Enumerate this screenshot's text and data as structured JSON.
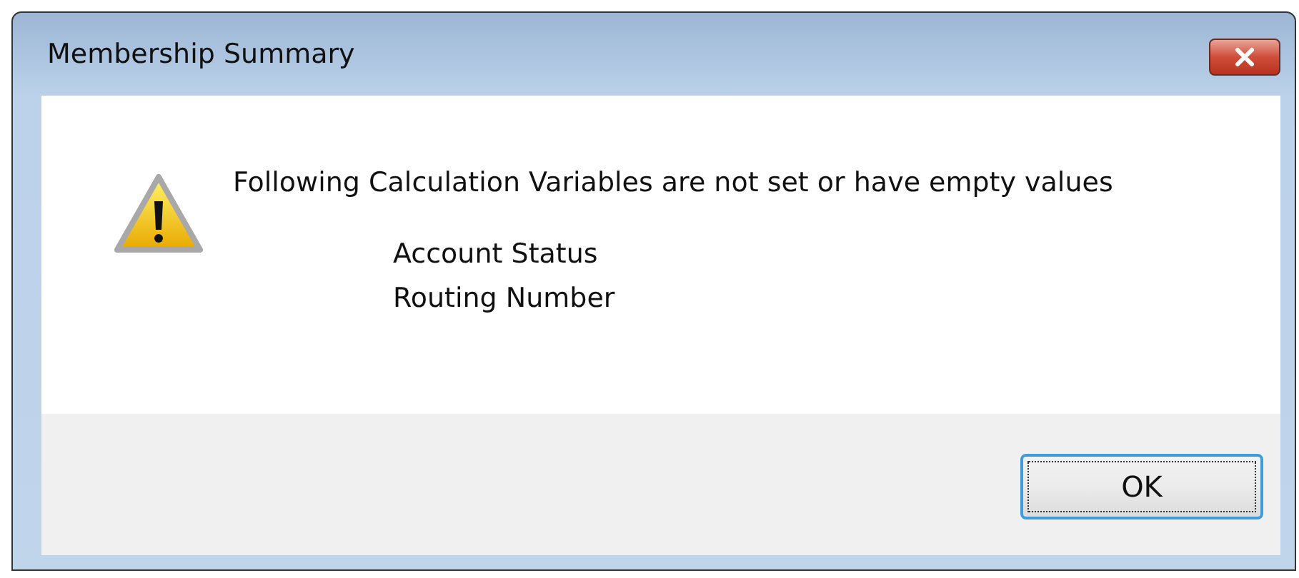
{
  "window": {
    "title": "Membership Summary"
  },
  "message": "Following Calculation Variables are not set or have empty values",
  "variables": [
    "Account Status",
    "Routing Number"
  ],
  "buttons": [
    {
      "label": "OK",
      "focused": true
    }
  ]
}
